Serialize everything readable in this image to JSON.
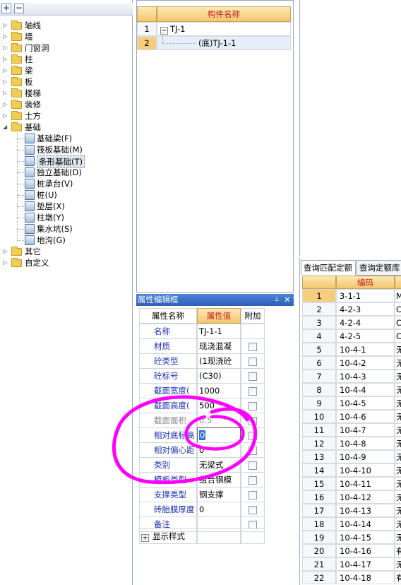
{
  "toolbar": {
    "expand_label": "+",
    "collapse_label": "−"
  },
  "tree": {
    "items": [
      {
        "label": "轴线",
        "expanded": false
      },
      {
        "label": "墙",
        "expanded": false
      },
      {
        "label": "门窗洞",
        "expanded": false
      },
      {
        "label": "柱",
        "expanded": false
      },
      {
        "label": "梁",
        "expanded": false
      },
      {
        "label": "板",
        "expanded": false
      },
      {
        "label": "楼梯",
        "expanded": false
      },
      {
        "label": "装修",
        "expanded": false
      },
      {
        "label": "土方",
        "expanded": false
      },
      {
        "label": "基础",
        "expanded": true
      },
      {
        "label": "其它",
        "expanded": false
      },
      {
        "label": "自定义",
        "expanded": false
      }
    ],
    "foundation_children": [
      {
        "label": "基础梁(F)",
        "icon": "foundation-beam-icon"
      },
      {
        "label": "筏板基础(M)",
        "icon": "raft-foundation-icon"
      },
      {
        "label": "条形基础(T)",
        "icon": "strip-foundation-icon",
        "selected": true
      },
      {
        "label": "独立基础(D)",
        "icon": "isolated-foundation-icon"
      },
      {
        "label": "桩承台(V)",
        "icon": "pile-cap-icon"
      },
      {
        "label": "桩(U)",
        "icon": "pile-icon"
      },
      {
        "label": "垫层(X)",
        "icon": "cushion-icon"
      },
      {
        "label": "柱墩(Y)",
        "icon": "column-pier-icon"
      },
      {
        "label": "集水坑(S)",
        "icon": "sump-pit-icon"
      },
      {
        "label": "地沟(G)",
        "icon": "trench-icon"
      }
    ]
  },
  "component_grid": {
    "header": "构件名称",
    "rows": [
      {
        "num": "1",
        "name": "TJ-1",
        "toggle": "−"
      },
      {
        "num": "2",
        "name": "(底)TJ-1-1"
      }
    ]
  },
  "properties": {
    "title": "属性编辑框",
    "pin_label": "📌",
    "close_label": "✕",
    "headers": {
      "name": "属性名称",
      "value": "属性值",
      "extra": "附加"
    },
    "rows": [
      {
        "name": "名称",
        "value": "TJ-1-1",
        "checkbox": false,
        "gray": false
      },
      {
        "name": "材质",
        "value": "现浇混凝",
        "checkbox": true,
        "gray": false
      },
      {
        "name": "砼类型",
        "value": "(1现浇砼",
        "checkbox": true,
        "gray": false
      },
      {
        "name": "砼标号",
        "value": "(C30)",
        "checkbox": true,
        "gray": false
      },
      {
        "name": "截面宽度(",
        "value": "1000",
        "checkbox": true,
        "gray": false
      },
      {
        "name": "截面高度(",
        "value": "500",
        "checkbox": true,
        "gray": false
      },
      {
        "name": "截面面积",
        "value": "0.5",
        "checkbox": true,
        "gray": true
      },
      {
        "name": "相对底标高",
        "value": "0",
        "checkbox": true,
        "gray": false,
        "editing": true
      },
      {
        "name": "相对偏心距",
        "value": "0",
        "checkbox": true,
        "gray": false
      },
      {
        "name": "类别",
        "value": "无梁式",
        "checkbox": true,
        "gray": false
      },
      {
        "name": "模板类型",
        "value": "组合钢模",
        "checkbox": true,
        "gray": false
      },
      {
        "name": "支撑类型",
        "value": "钢支撑",
        "checkbox": true,
        "gray": false
      },
      {
        "name": "砖胎膜厚度",
        "value": "0",
        "checkbox": true,
        "gray": false
      },
      {
        "name": "备注",
        "value": "",
        "checkbox": true,
        "gray": false
      }
    ],
    "footer": {
      "toggle": "+",
      "label": "显示样式"
    }
  },
  "query": {
    "tabs": [
      "查询匹配定额",
      "查询定额库"
    ],
    "header": "编码",
    "rows": [
      {
        "num": "1",
        "code": "3-1-1",
        "extra": "M"
      },
      {
        "num": "2",
        "code": "4-2-3",
        "extra": "C"
      },
      {
        "num": "3",
        "code": "4-2-4",
        "extra": "C"
      },
      {
        "num": "4",
        "code": "4-2-5",
        "extra": "C"
      },
      {
        "num": "5",
        "code": "10-4-1",
        "extra": "无"
      },
      {
        "num": "6",
        "code": "10-4-2",
        "extra": "无"
      },
      {
        "num": "7",
        "code": "10-4-3",
        "extra": "无"
      },
      {
        "num": "8",
        "code": "10-4-4",
        "extra": "无"
      },
      {
        "num": "9",
        "code": "10-4-5",
        "extra": "无"
      },
      {
        "num": "10",
        "code": "10-4-6",
        "extra": "无"
      },
      {
        "num": "11",
        "code": "10-4-7",
        "extra": "无"
      },
      {
        "num": "12",
        "code": "10-4-8",
        "extra": "无"
      },
      {
        "num": "13",
        "code": "10-4-9",
        "extra": "无"
      },
      {
        "num": "14",
        "code": "10-4-10",
        "extra": "无"
      },
      {
        "num": "15",
        "code": "10-4-11",
        "extra": "无"
      },
      {
        "num": "16",
        "code": "10-4-12",
        "extra": "无"
      },
      {
        "num": "17",
        "code": "10-4-13",
        "extra": "无"
      },
      {
        "num": "18",
        "code": "10-4-14",
        "extra": "无"
      },
      {
        "num": "19",
        "code": "10-4-15",
        "extra": "无"
      },
      {
        "num": "20",
        "code": "10-4-16",
        "extra": "有"
      },
      {
        "num": "21",
        "code": "10-4-17",
        "extra": "无"
      },
      {
        "num": "22",
        "code": "10-4-18",
        "extra": "有"
      }
    ]
  },
  "colors": {
    "annotation": "#ff00ff",
    "selected_row": "#f6cd7c",
    "title_bar": "#2d5fb7"
  }
}
